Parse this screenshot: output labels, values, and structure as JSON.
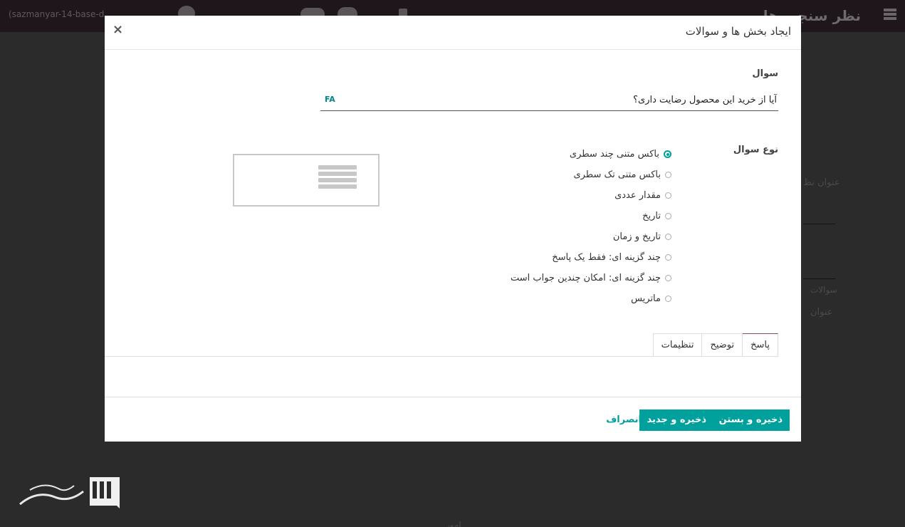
{
  "background": {
    "app_name": "نظر سنجی ها",
    "db_name": "(sazmanyar-14-base-d...",
    "field_title_label": "عنوان نظ",
    "questions_label": "سوالات",
    "title_col": "عنوان",
    "bottom_text": "امور"
  },
  "modal": {
    "title": "ایجاد بخش ها و سوالات",
    "close": "×",
    "question_label": "سوال",
    "question_value": "آیا از خرید این محصول رضایت داری؟",
    "lang_badge": "FA",
    "type_label": "نوع سوال",
    "question_types": [
      {
        "label": "باکس متنی چند سطری",
        "selected": true
      },
      {
        "label": "باکس متنی تک سطری",
        "selected": false
      },
      {
        "label": "مقدار عددی",
        "selected": false
      },
      {
        "label": "تاریخ",
        "selected": false
      },
      {
        "label": "تاریخ و زمان",
        "selected": false
      },
      {
        "label": "چند گزینه ای: فقط یک پاسخ",
        "selected": false
      },
      {
        "label": "چند گزینه ای: امکان چندین جواب است",
        "selected": false
      },
      {
        "label": "ماتریس",
        "selected": false
      }
    ],
    "tabs": [
      "پاسخ",
      "توضیح",
      "تنظیمات"
    ],
    "active_tab": "پاسخ",
    "buttons": {
      "save_close": "ذخیره و بستن",
      "save_new": "ذخیره و جدید",
      "cancel": "انصراف"
    }
  },
  "colors": {
    "accent": "#00a09d",
    "tab_active_border": "#7c4a6e",
    "topbar": "#1e161b",
    "overlay": "#2b2b2b"
  }
}
